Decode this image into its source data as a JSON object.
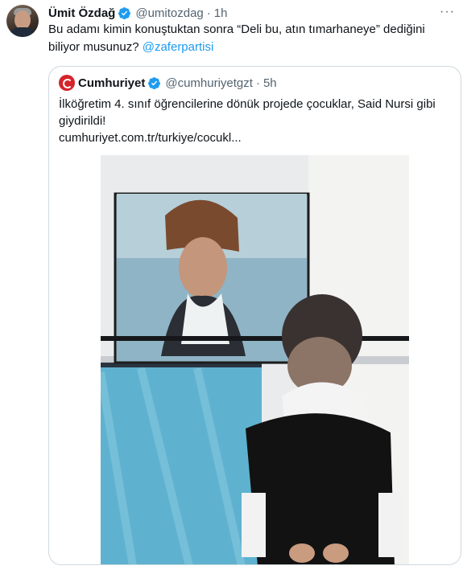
{
  "tweet": {
    "author_name": "Ümit Özdağ",
    "handle": "@umitozdag",
    "time": "1h",
    "text": "Bu adamı kimin konuştuktan sonra “Deli bu, atın tımarhaneye” dediğini biliyor musunuz?",
    "mention": "@zaferpartisi",
    "more_icon": "more-icon"
  },
  "quoted": {
    "author_name": "Cumhuriyet",
    "handle": "@cumhuriyetgzt",
    "time": "5h",
    "text": "İlköğretim 4. sınıf öğrencilerine dönük projede çocuklar, Said Nursi gibi giydirildi!",
    "url": "cumhuriyet.com.tr/turkiye/cocukl..."
  },
  "colors": {
    "verified": "#1d9bf0",
    "link": "#1d9bf0",
    "muted": "#536471",
    "border": "#cfd9de",
    "brand": "#d5242b"
  }
}
